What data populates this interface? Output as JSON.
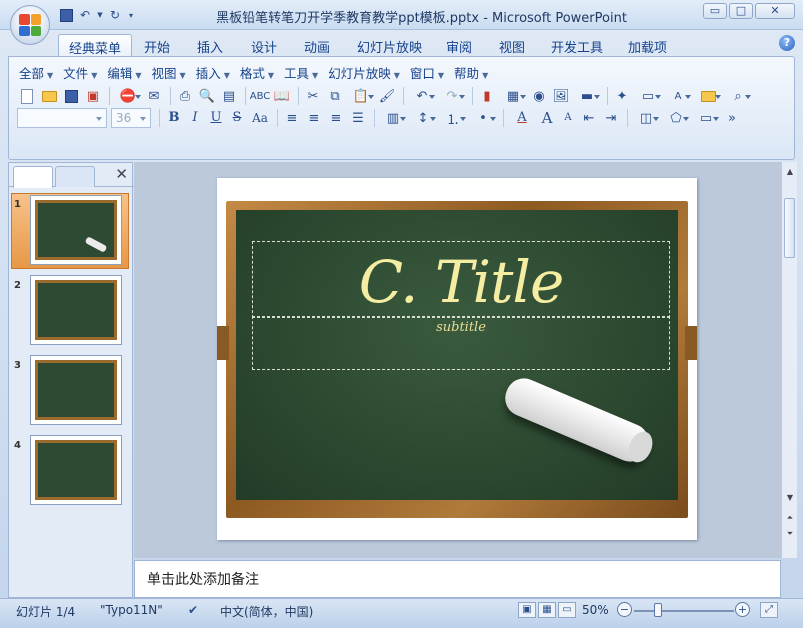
{
  "app": {
    "window_title": "黑板铅笔转笔刀开学季教育教学ppt模板.pptx - Microsoft PowerPoint"
  },
  "qat": {
    "save_icon": "save-icon",
    "undo_icon": "undo-icon",
    "redo_icon": "redo-icon",
    "customize_icon": "customize-qat-icon"
  },
  "window_controls": {
    "minimize": "▭",
    "maximize": "□",
    "close": "✕"
  },
  "ribbon_tabs": [
    {
      "label": "经典菜单",
      "active": true
    },
    {
      "label": "开始"
    },
    {
      "label": "插入"
    },
    {
      "label": "设计"
    },
    {
      "label": "动画"
    },
    {
      "label": "幻灯片放映"
    },
    {
      "label": "审阅"
    },
    {
      "label": "视图"
    },
    {
      "label": "开发工具"
    },
    {
      "label": "加载项"
    }
  ],
  "menus": [
    "全部",
    "文件",
    "编辑",
    "视图",
    "插入",
    "格式",
    "工具",
    "幻灯片放映",
    "窗口",
    "帮助"
  ],
  "toolbar": {
    "font_name": "",
    "font_size": "36",
    "bold": "B",
    "italic": "I",
    "underline": "U",
    "strikethrough": "S",
    "change_case": "Aa",
    "text_color": "A",
    "grow_font": "A",
    "shrink_font": "A"
  },
  "slides_pane": {
    "slides": [
      {
        "number": "1",
        "selected": true
      },
      {
        "number": "2"
      },
      {
        "number": "3"
      },
      {
        "number": "4"
      }
    ]
  },
  "slide": {
    "title": "C. Title",
    "subtitle": "subtitle"
  },
  "notes": {
    "placeholder": "单击此处添加备注"
  },
  "status": {
    "slide_indicator": "幻灯片 1/4",
    "theme": "\"Typo11N\"",
    "language": "中文(简体，中国)",
    "zoom": "50%"
  },
  "colors": {
    "board": "#2d4a31",
    "frame": "#9b6b2e",
    "title_chalk": "#f4eda2",
    "selection": "#e79846"
  }
}
